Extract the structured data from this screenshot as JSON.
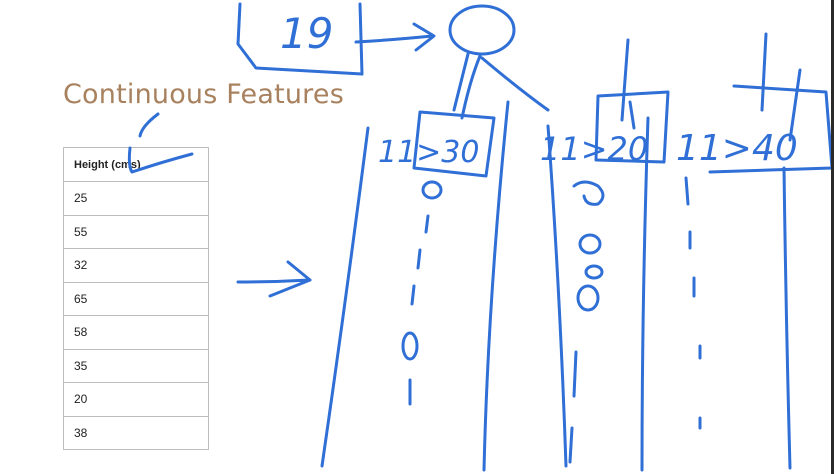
{
  "slide": {
    "title": "Continuous Features"
  },
  "table": {
    "header": "Height (cms)",
    "rows": [
      "25",
      "55",
      "32",
      "65",
      "58",
      "35",
      "20",
      "38"
    ]
  },
  "annotations": {
    "root_label": "19",
    "split_labels": [
      "11>30",
      "11>20",
      "11>40"
    ],
    "ink_color": "#2f6fd6"
  }
}
